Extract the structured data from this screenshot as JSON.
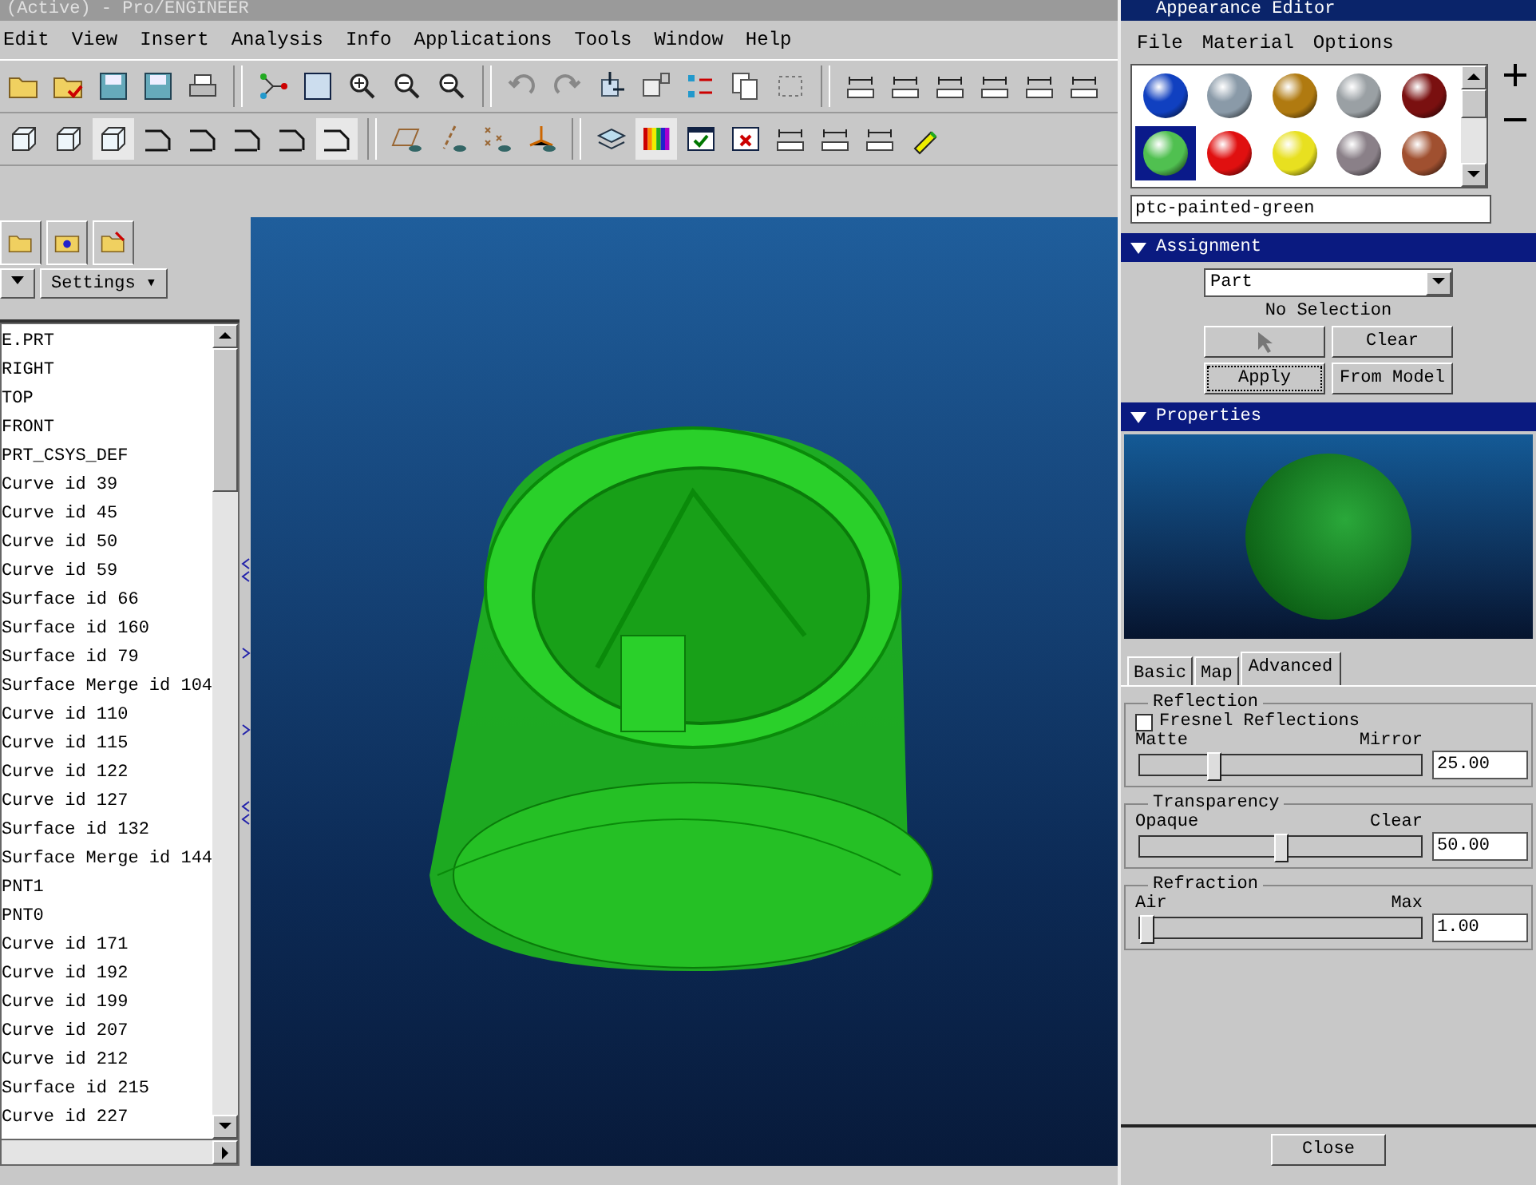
{
  "window": {
    "title": "(Active) - Pro/ENGINEER"
  },
  "menu": [
    "Edit",
    "View",
    "Insert",
    "Analysis",
    "Info",
    "Applications",
    "Tools",
    "Window",
    "Help"
  ],
  "navigator": {
    "settings": "Settings ▾",
    "items": [
      "E.PRT",
      "RIGHT",
      "TOP",
      "FRONT",
      "PRT_CSYS_DEF",
      "Curve id 39",
      "Curve id 45",
      "Curve id 50",
      "Curve id 59",
      "Surface id 66",
      "Surface id 160",
      "Surface id 79",
      "Surface Merge id 104",
      "Curve id 110",
      "Curve id 115",
      "Curve id 122",
      "Curve id 127",
      "Surface id 132",
      "Surface Merge id 144",
      "PNT1",
      "PNT0",
      "Curve id 171",
      "Curve id 192",
      "Curve id 199",
      "Curve id 207",
      "Curve id 212",
      "Surface id 215",
      "Curve id 227"
    ]
  },
  "appearance_editor": {
    "title": "Appearance Editor",
    "menu": [
      "File",
      "Material",
      "Options"
    ],
    "swatches": [
      {
        "color": "#1040c0",
        "selected": false
      },
      {
        "color": "#8a9aa8",
        "selected": false
      },
      {
        "color": "#b07a10",
        "selected": false
      },
      {
        "color": "#9aa0a4",
        "selected": false
      },
      {
        "color": "#7a1010",
        "selected": false
      },
      {
        "color": "#50c050",
        "selected": true
      },
      {
        "color": "#e01010",
        "selected": false
      },
      {
        "color": "#e8e020",
        "selected": false
      },
      {
        "color": "#8a8088",
        "selected": false
      },
      {
        "color": "#a05030",
        "selected": false
      }
    ],
    "name": "ptc-painted-green",
    "assignment": {
      "title": "Assignment",
      "dropdown": "Part",
      "status": "No Selection",
      "clear": "Clear",
      "apply": "Apply",
      "from_model": "From Model"
    },
    "properties": {
      "title": "Properties"
    },
    "tabs": [
      {
        "label": "Basic",
        "selected": false
      },
      {
        "label": "Map",
        "selected": false
      },
      {
        "label": "Advanced",
        "selected": true
      }
    ],
    "groups": [
      {
        "title": "Reflection",
        "checkbox": {
          "label": "Fresnel Reflections",
          "checked": false
        },
        "min_label": "Matte",
        "max_label": "Mirror",
        "level": 0.25,
        "value": "25.00"
      },
      {
        "title": "Transparency",
        "min_label": "Opaque",
        "max_label": "Clear",
        "level": 0.5,
        "value": "50.00"
      },
      {
        "title": "Refraction",
        "min_label": "Air",
        "max_label": "Max",
        "level": 0,
        "value": "1.00"
      }
    ],
    "close": "Close"
  }
}
